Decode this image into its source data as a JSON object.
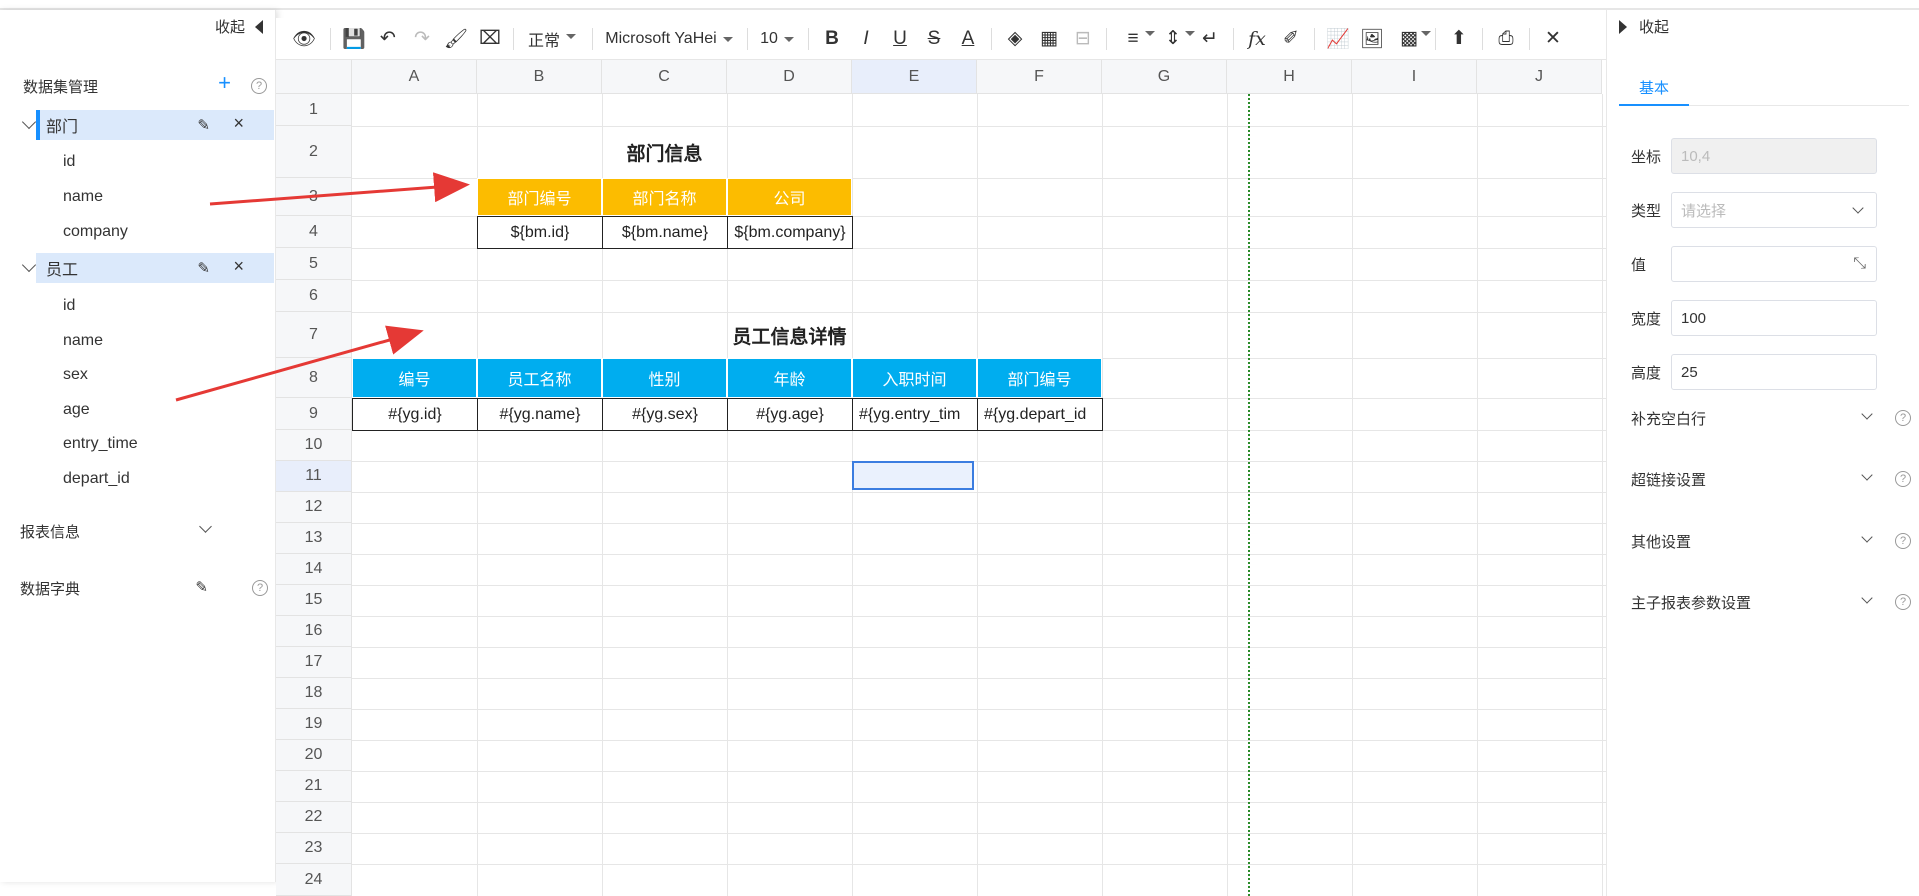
{
  "left_panel": {
    "collapse_label": "收起",
    "dataset_header": "数据集管理",
    "add_symbol": "+",
    "help_symbol": "?",
    "groups": [
      {
        "label": "部门",
        "fields": [
          "id",
          "name",
          "company"
        ]
      },
      {
        "label": "员工",
        "fields": [
          "id",
          "name",
          "sex",
          "age",
          "entry_time",
          "depart_id"
        ]
      }
    ],
    "report_info": "报表信息",
    "data_dict": "数据字典",
    "edit_symbol": "✎",
    "close_symbol": "×"
  },
  "toolbar": {
    "format": "正常",
    "font": "Microsoft YaHei",
    "size": "10",
    "icons": {
      "preview": "👁",
      "save": "💾",
      "undo": "↶",
      "redo": "↷",
      "paint": "🖌",
      "clear": "⌧",
      "bold": "B",
      "italic": "I",
      "underline": "U",
      "strike": "S",
      "fontcolor": "A",
      "fill": "◈",
      "border": "▦",
      "merge": "⊟",
      "align": "≡",
      "valign": "⇕",
      "wrap": "↵",
      "fx": "fx",
      "format_brush": "✐",
      "chart": "📈",
      "image": "🖼",
      "qrcode": "▩",
      "upload": "⬆",
      "print": "⎙",
      "tools": "✕"
    }
  },
  "grid": {
    "columns": [
      "A",
      "B",
      "C",
      "D",
      "E",
      "F",
      "G",
      "H",
      "I",
      "J"
    ],
    "rows": [
      "1",
      "2",
      "3",
      "4",
      "5",
      "6",
      "7",
      "8",
      "9",
      "10",
      "11",
      "12",
      "13",
      "14",
      "15",
      "16",
      "17",
      "18",
      "19",
      "20",
      "21",
      "22",
      "23",
      "24"
    ],
    "dept_title": "部门信息",
    "dept_headers": [
      "部门编号",
      "部门名称",
      "公司"
    ],
    "dept_values": [
      "${bm.id}",
      "${bm.name}",
      "${bm.company}"
    ],
    "emp_title": "员工信息详情",
    "emp_headers": [
      "编号",
      "员工名称",
      "性别",
      "年龄",
      "入职时间",
      "部门编号"
    ],
    "emp_values": [
      "#{yg.id}",
      "#{yg.name}",
      "#{yg.sex}",
      "#{yg.age}",
      "#{yg.entry_tim",
      "#{yg.depart_id"
    ],
    "colors": {
      "yellow_header": "#fcbc00",
      "blue_header": "#00adef"
    }
  },
  "right_panel": {
    "collapse_label": "收起",
    "tab": "基本",
    "coord_label": "坐标",
    "coord_value": "10,4",
    "type_label": "类型",
    "type_placeholder": "请选择",
    "value_label": "值",
    "width_label": "宽度",
    "width_value": "100",
    "height_label": "高度",
    "height_value": "25",
    "sections": [
      "补充空白行",
      "超链接设置",
      "其他设置",
      "主子报表参数设置"
    ],
    "expand_icon": "⤡"
  }
}
